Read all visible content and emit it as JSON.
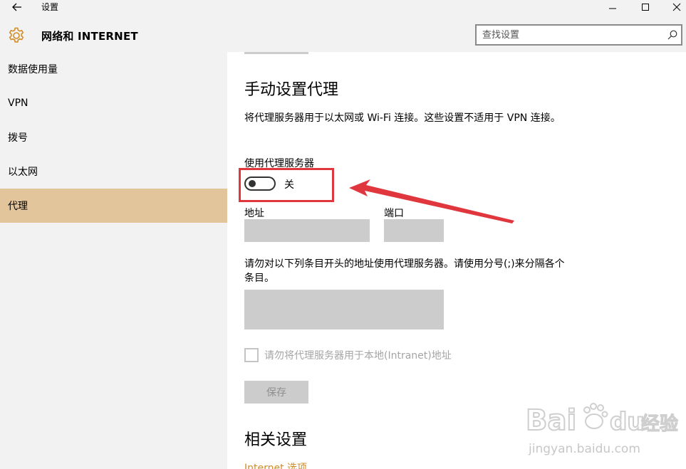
{
  "window": {
    "title": "设置"
  },
  "header": {
    "title": "网络和 INTERNET",
    "search_placeholder": "查找设置"
  },
  "sidebar": {
    "items": [
      {
        "label": "数据使用量",
        "active": false
      },
      {
        "label": "VPN",
        "active": false
      },
      {
        "label": "拨号",
        "active": false
      },
      {
        "label": "以太网",
        "active": false
      },
      {
        "label": "代理",
        "active": true
      }
    ]
  },
  "main": {
    "section_title": "手动设置代理",
    "description": "将代理服务器用于以太网或 Wi-Fi 连接。这些设置不适用于 VPN 连接。",
    "use_proxy_label": "使用代理服务器",
    "toggle_state": "关",
    "address_label": "地址",
    "address_value": "",
    "port_label": "端口",
    "port_value": "",
    "exceptions_description": "请勿对以下列条目开头的地址使用代理服务器。请使用分号(;)来分隔各个条目。",
    "exceptions_value": "",
    "local_checkbox_label": "请勿将代理服务器用于本地(Intranet)地址",
    "save_label": "保存",
    "related_title": "相关设置",
    "related_link": "Internet 选项"
  },
  "watermark": {
    "brand": "Bai",
    "brand_suffix": "du",
    "product": "经验",
    "url": "jingyan.baidu.com"
  },
  "colors": {
    "chrome_bg": "#f2f2f2",
    "accent_selected": "#e3c59c",
    "link": "#d28c25",
    "annotation": "#e0363d",
    "field_bg": "#cccccc"
  }
}
